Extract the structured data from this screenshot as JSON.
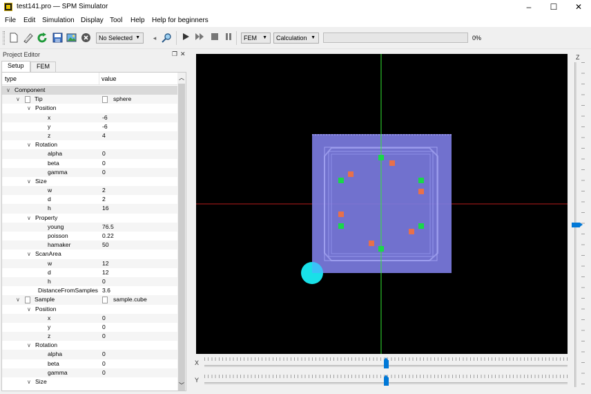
{
  "window": {
    "title": "test141.pro — SPM Simulator",
    "minimize_icon": "–",
    "maximize_icon": "☐",
    "close_icon": "✕"
  },
  "menu": [
    "File",
    "Edit",
    "Simulation",
    "Display",
    "Tool",
    "Help",
    "Help for beginners"
  ],
  "toolbar": {
    "select_value": "No Selected",
    "mode_value": "FEM",
    "calc_value": "Calculation",
    "progress_text": "0%",
    "progress": 0
  },
  "panel": {
    "title": "Project Editor",
    "float_icon": "❐",
    "close_icon": "✕",
    "tabs": [
      "Setup",
      "FEM"
    ],
    "columns": [
      "type",
      "value"
    ]
  },
  "tree": [
    {
      "label": "Component",
      "value": "",
      "level": 0,
      "expander": "open",
      "file": false,
      "vfile": false
    },
    {
      "label": "Tip",
      "value": "sphere",
      "level": 1,
      "expander": "open",
      "file": true,
      "vfile": true
    },
    {
      "label": "Position",
      "value": "",
      "level": 2,
      "expander": "open",
      "file": false,
      "vfile": false
    },
    {
      "label": "x",
      "value": "-6",
      "level": 3,
      "expander": "none",
      "file": false,
      "vfile": false
    },
    {
      "label": "y",
      "value": "-6",
      "level": 3,
      "expander": "none",
      "file": false,
      "vfile": false
    },
    {
      "label": "z",
      "value": "4",
      "level": 3,
      "expander": "none",
      "file": false,
      "vfile": false
    },
    {
      "label": "Rotation",
      "value": "",
      "level": 2,
      "expander": "open",
      "file": false,
      "vfile": false
    },
    {
      "label": "alpha",
      "value": "0",
      "level": 3,
      "expander": "none",
      "file": false,
      "vfile": false
    },
    {
      "label": "beta",
      "value": "0",
      "level": 3,
      "expander": "none",
      "file": false,
      "vfile": false
    },
    {
      "label": "gamma",
      "value": "0",
      "level": 3,
      "expander": "none",
      "file": false,
      "vfile": false
    },
    {
      "label": "Size",
      "value": "",
      "level": 2,
      "expander": "open",
      "file": false,
      "vfile": false
    },
    {
      "label": "w",
      "value": "2",
      "level": 3,
      "expander": "none",
      "file": false,
      "vfile": false
    },
    {
      "label": "d",
      "value": "2",
      "level": 3,
      "expander": "none",
      "file": false,
      "vfile": false
    },
    {
      "label": "h",
      "value": "16",
      "level": 3,
      "expander": "none",
      "file": false,
      "vfile": false
    },
    {
      "label": "Property",
      "value": "",
      "level": 2,
      "expander": "open",
      "file": false,
      "vfile": false
    },
    {
      "label": "young",
      "value": "76.5",
      "level": 3,
      "expander": "none",
      "file": false,
      "vfile": false
    },
    {
      "label": "poisson",
      "value": "0.22",
      "level": 3,
      "expander": "none",
      "file": false,
      "vfile": false
    },
    {
      "label": "hamaker",
      "value": "50",
      "level": 3,
      "expander": "none",
      "file": false,
      "vfile": false
    },
    {
      "label": "ScanArea",
      "value": "",
      "level": 2,
      "expander": "open",
      "file": false,
      "vfile": false
    },
    {
      "label": "w",
      "value": "12",
      "level": 3,
      "expander": "none",
      "file": false,
      "vfile": false
    },
    {
      "label": "d",
      "value": "12",
      "level": 3,
      "expander": "none",
      "file": false,
      "vfile": false
    },
    {
      "label": "h",
      "value": "0",
      "level": 3,
      "expander": "none",
      "file": false,
      "vfile": false
    },
    {
      "label": "DistanceFromSamples",
      "value": "3.6",
      "level": 2,
      "expander": "none",
      "file": false,
      "vfile": false
    },
    {
      "label": "Sample",
      "value": "sample.cube",
      "level": 1,
      "expander": "open",
      "file": true,
      "vfile": true
    },
    {
      "label": "Position",
      "value": "",
      "level": 2,
      "expander": "open",
      "file": false,
      "vfile": false
    },
    {
      "label": "x",
      "value": "0",
      "level": 3,
      "expander": "none",
      "file": false,
      "vfile": false
    },
    {
      "label": "y",
      "value": "0",
      "level": 3,
      "expander": "none",
      "file": false,
      "vfile": false
    },
    {
      "label": "z",
      "value": "0",
      "level": 3,
      "expander": "none",
      "file": false,
      "vfile": false
    },
    {
      "label": "Rotation",
      "value": "",
      "level": 2,
      "expander": "open",
      "file": false,
      "vfile": false
    },
    {
      "label": "alpha",
      "value": "0",
      "level": 3,
      "expander": "none",
      "file": false,
      "vfile": false
    },
    {
      "label": "beta",
      "value": "0",
      "level": 3,
      "expander": "none",
      "file": false,
      "vfile": false
    },
    {
      "label": "gamma",
      "value": "0",
      "level": 3,
      "expander": "none",
      "file": false,
      "vfile": false
    },
    {
      "label": "Size",
      "value": "",
      "level": 2,
      "expander": "open",
      "file": false,
      "vfile": false
    }
  ],
  "viewport": {
    "background": "#000000",
    "sample_color": "#7b7be0",
    "tip_color": "#19e0e8",
    "axis_v_color": "#33e833",
    "axis_h_color": "#b81b1b",
    "green_marker": "#19d84a",
    "orange_marker": "#e8704a"
  },
  "sliders": {
    "x_label": "X",
    "y_label": "Y",
    "z_label": "Z",
    "x_value": 0.5,
    "y_value": 0.5,
    "z_value": 0.5
  }
}
